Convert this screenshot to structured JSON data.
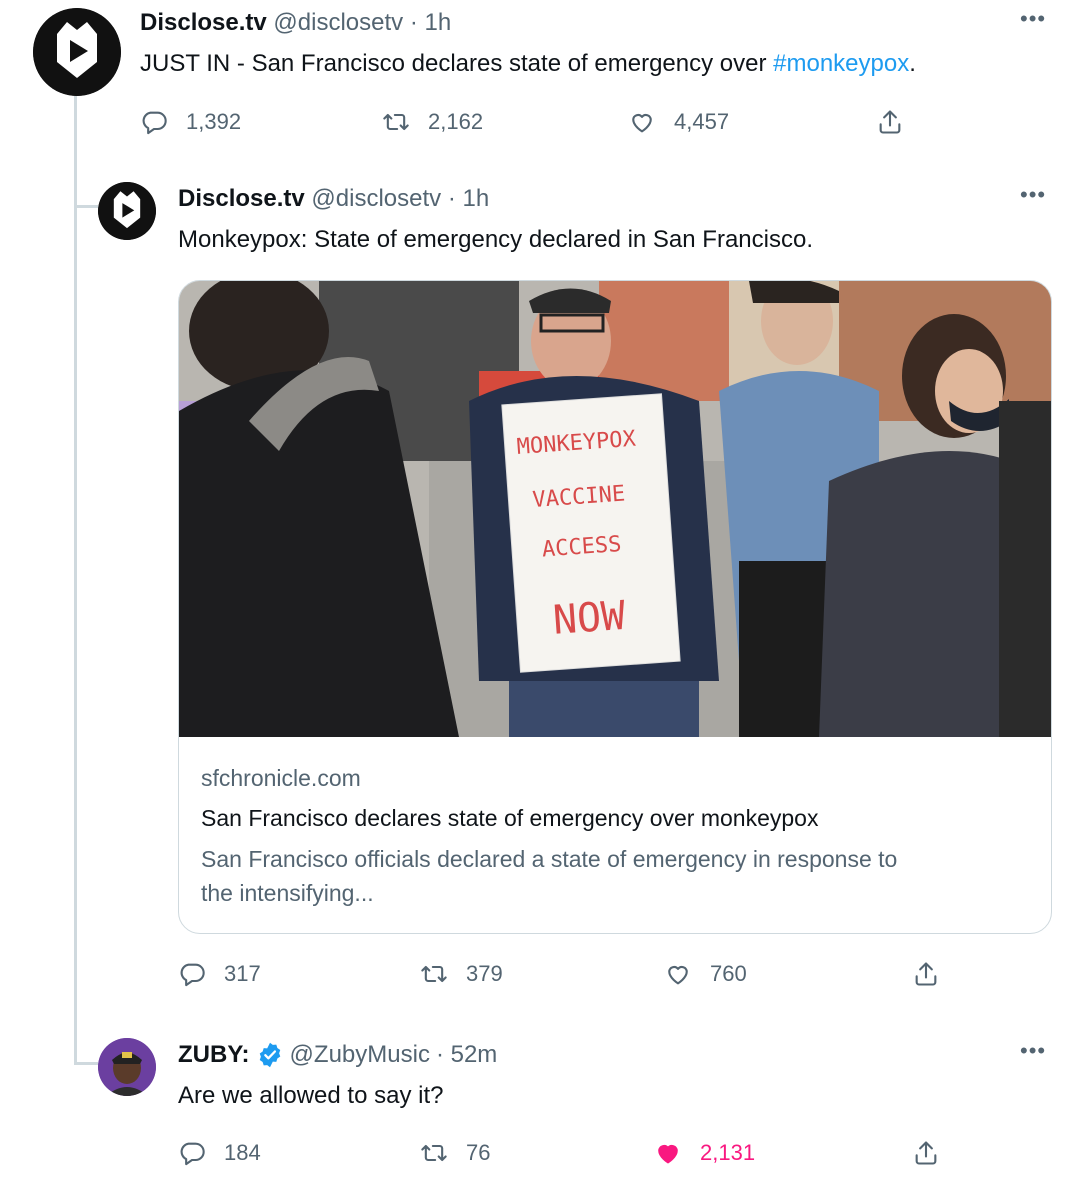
{
  "tweet1": {
    "name": "Disclose.tv",
    "handle": "@disclosetv",
    "time": "· 1h",
    "text_prefix": "JUST IN - San Francisco declares state of emergency over ",
    "hashtag": "#monkeypox",
    "text_suffix": ".",
    "replies": "1,392",
    "retweets": "2,162",
    "likes": "4,457"
  },
  "tweet2": {
    "name": "Disclose.tv",
    "handle": "@disclosetv",
    "time": "· 1h",
    "text": "Monkeypox: State of emergency declared in San Francisco.",
    "card": {
      "sign_line1": "MONKEYPOX",
      "sign_line2": "VACCINE",
      "sign_line3": "ACCESS",
      "sign_line4": "NOW",
      "domain": "sfchronicle.com",
      "title": "San Francisco declares state of emergency over monkeypox",
      "description_line1": "San Francisco officials declared a state of emergency in response to",
      "description_line2": "the intensifying..."
    },
    "replies": "317",
    "retweets": "379",
    "likes": "760"
  },
  "tweet3": {
    "name": "ZUBY:",
    "handle": "@ZubyMusic",
    "time": "· 52m",
    "text": "Are we allowed to say it?",
    "replies": "184",
    "retweets": "76",
    "likes": "2,131"
  },
  "colors": {
    "accent": "#1d9bf0",
    "like_active": "#f91880",
    "muted": "#536471",
    "verified": "#1d9bf0"
  },
  "icons": [
    "reply-icon",
    "retweet-icon",
    "like-icon",
    "share-icon",
    "more-icon",
    "verified-badge-icon"
  ]
}
